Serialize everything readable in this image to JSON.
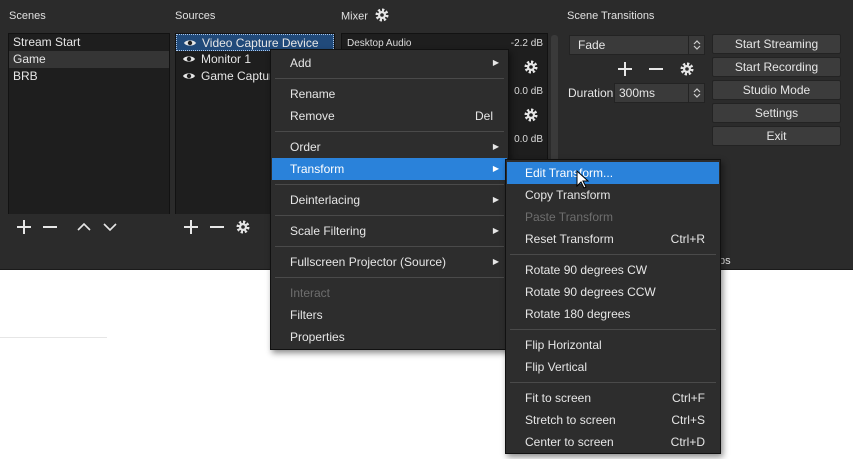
{
  "docks": {
    "scenes_title": "Scenes",
    "sources_title": "Sources",
    "mixer_title": "Mixer",
    "transitions_title": "Scene Transitions",
    "controls_partial": "ps"
  },
  "scenes": [
    "Stream Start",
    "Game",
    "BRB"
  ],
  "sources": [
    "Video Capture Device",
    "Monitor 1",
    "Game Capture"
  ],
  "mixer": {
    "channel_name": "Desktop Audio",
    "levels": [
      "-2.2 dB",
      "0.0 dB",
      "0.0 dB"
    ]
  },
  "transitions": {
    "selected": "Fade",
    "duration_label": "Duration",
    "duration_value": "300ms"
  },
  "controls": {
    "start_streaming": "Start Streaming",
    "start_recording": "Start Recording",
    "studio_mode": "Studio Mode",
    "settings": "Settings",
    "exit": "Exit"
  },
  "context_menu": {
    "add": "Add",
    "rename": "Rename",
    "remove": "Remove",
    "remove_shortcut": "Del",
    "order": "Order",
    "transform": "Transform",
    "deinterlacing": "Deinterlacing",
    "scale_filtering": "Scale Filtering",
    "fullscreen_projector": "Fullscreen Projector (Source)",
    "interact": "Interact",
    "filters": "Filters",
    "properties": "Properties"
  },
  "transform_menu": {
    "edit_transform": "Edit Transform...",
    "copy_transform": "Copy Transform",
    "paste_transform": "Paste Transform",
    "reset_transform": "Reset Transform",
    "reset_shortcut": "Ctrl+R",
    "rotate_cw": "Rotate 90 degrees CW",
    "rotate_ccw": "Rotate 90 degrees CCW",
    "rotate_180": "Rotate 180 degrees",
    "flip_h": "Flip Horizontal",
    "flip_v": "Flip Vertical",
    "fit": "Fit to screen",
    "fit_shortcut": "Ctrl+F",
    "stretch": "Stretch to screen",
    "stretch_shortcut": "Ctrl+S",
    "center": "Center to screen",
    "center_shortcut": "Ctrl+D"
  },
  "colors": {
    "accent": "#2a82da",
    "panel": "#2b2b2b",
    "list_bg": "#1e1e1e"
  }
}
